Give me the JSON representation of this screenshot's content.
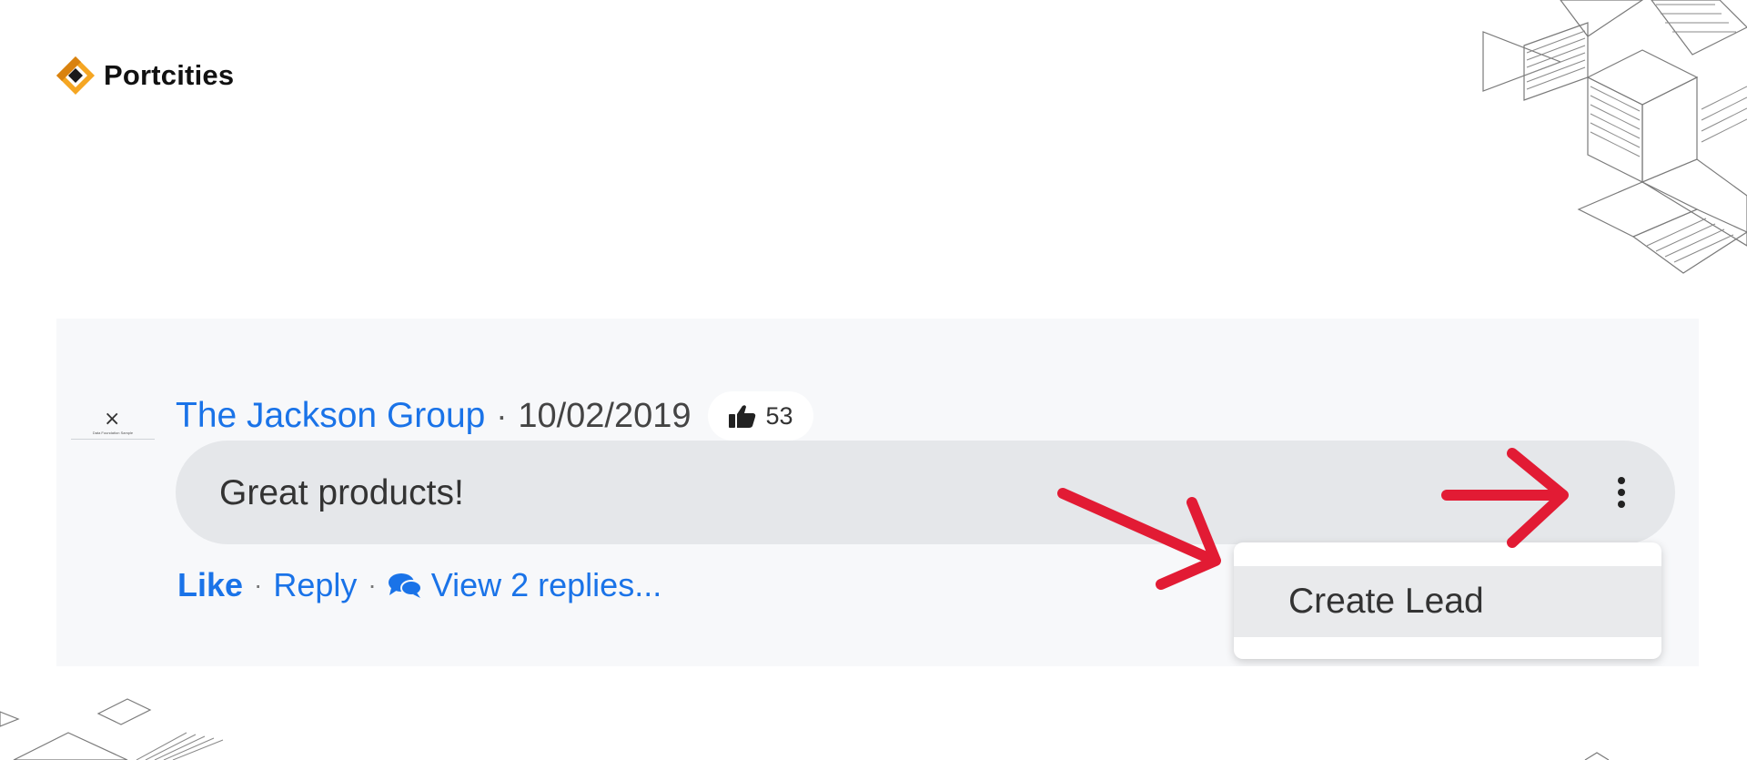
{
  "brand": {
    "name": "Portcities",
    "logo_color": "#f5a623"
  },
  "comment": {
    "author": "The Jackson Group",
    "separator": "·",
    "date": "10/02/2019",
    "like_count": "53",
    "text": "Great products!",
    "avatar_symbol": "×",
    "avatar_caption": "Data Foundation Sample"
  },
  "actions": {
    "like": "Like",
    "reply": "Reply",
    "view_replies": "View 2 replies...",
    "separator": "·"
  },
  "menu": {
    "items": [
      {
        "label": "Create Lead"
      }
    ]
  },
  "colors": {
    "link": "#1a73e8",
    "annotation": "#e21b34",
    "panel_bg": "#f7f8fa",
    "bubble_bg": "#e5e7ea"
  },
  "icons": [
    "thumbs-up-icon",
    "comments-icon",
    "kebab-menu-icon",
    "annotation-arrow"
  ]
}
